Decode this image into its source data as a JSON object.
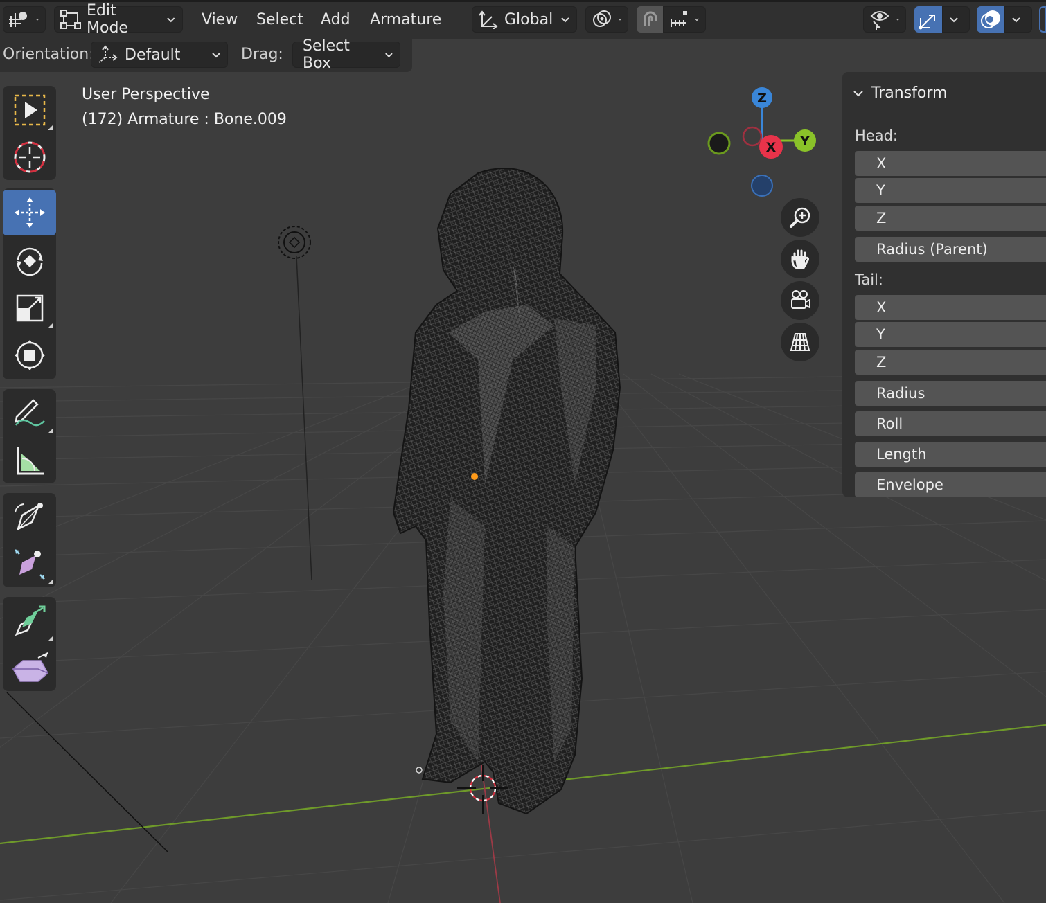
{
  "header": {
    "mode_label": "Edit Mode",
    "menus": [
      "View",
      "Select",
      "Add",
      "Armature"
    ],
    "transform_orientation": "Global",
    "icons": [
      "editor-type-icon",
      "edit-mode-icon",
      "orientation-icon",
      "pivot-icon",
      "snap-magnet-icon",
      "snap-increment-icon",
      "visibility-eye-icon",
      "gizmo-icon",
      "overlay-icon"
    ],
    "accent_color": "#4772b3"
  },
  "tool_settings": {
    "orientation_label": "Orientation:",
    "orientation_value": "Default",
    "drag_label": "Drag:",
    "drag_value": "Select Box"
  },
  "viewport": {
    "view_name": "User Perspective",
    "context_info": "(172) Armature : Bone.009"
  },
  "toolbar": {
    "tools": [
      "select-box",
      "cursor",
      "move",
      "rotate",
      "scale",
      "transform",
      "annotate",
      "measure",
      "roll",
      "bone-size",
      "extrude",
      "shear"
    ],
    "active_tool": "move"
  },
  "gizmo": {
    "axes": {
      "x": "X",
      "y": "Y",
      "z": "Z"
    },
    "colors": {
      "x": "#e8334a",
      "y": "#8ac229",
      "z": "#3a86d8"
    },
    "nav_buttons": [
      "zoom-icon",
      "pan-hand-icon",
      "camera-icon",
      "perspective-grid-icon"
    ]
  },
  "sidebar": {
    "panel_title": "Transform",
    "head_label": "Head:",
    "head_fields": [
      "X",
      "Y",
      "Z",
      "Radius (Parent)"
    ],
    "tail_label": "Tail:",
    "tail_fields": [
      "X",
      "Y",
      "Z"
    ],
    "extra_fields": [
      "Radius",
      "Roll",
      "Length",
      "Envelope"
    ]
  }
}
